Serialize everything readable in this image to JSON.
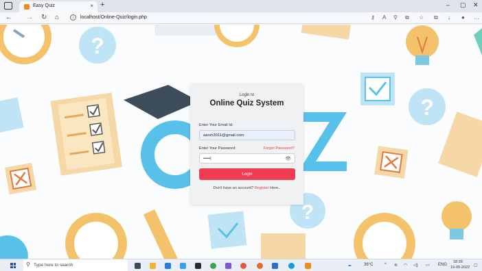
{
  "browser": {
    "tab_title": "Easy Quiz",
    "tab_close": "×",
    "new_tab": "+",
    "url": "localhost/Online-Quiz/login.php",
    "minimize": "–",
    "maximize": "▢",
    "close": "✕"
  },
  "login": {
    "subtitle": "Login to",
    "title": "Online Quiz System",
    "email_label": "Enter Your Email Id:",
    "email_value": "aarsh3011@gmail.com",
    "password_label": "Enter Your Password:",
    "password_value": "•••••|",
    "forgot_link": "Forgot Password?",
    "login_button": "Login",
    "signup_prefix": "Don't have an account?",
    "signup_link": "Register",
    "signup_suffix": "Here.."
  },
  "taskbar": {
    "search_placeholder": "Type here to search",
    "weather": "36°C",
    "language": "ENG",
    "time": "18:39",
    "date": "19-05-2022"
  }
}
